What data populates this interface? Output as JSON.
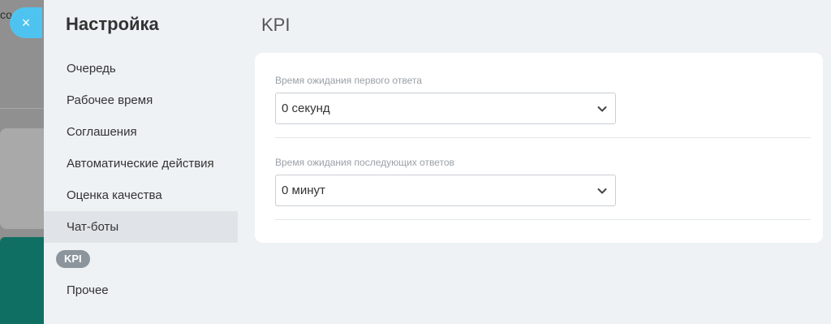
{
  "background": {
    "top_text": "со"
  },
  "close_button": {
    "icon": "×"
  },
  "sidebar": {
    "title": "Настройка",
    "items": [
      {
        "label": "Очередь"
      },
      {
        "label": "Рабочее время"
      },
      {
        "label": "Соглашения"
      },
      {
        "label": "Автоматические действия"
      },
      {
        "label": "Оценка качества"
      },
      {
        "label": "Чат-боты"
      },
      {
        "label": "KPI"
      },
      {
        "label": "Прочее"
      }
    ]
  },
  "main": {
    "title": "KPI",
    "fields": [
      {
        "label": "Время ожидания первого ответа",
        "value": "0 секунд"
      },
      {
        "label": "Время ожидания последующих ответов",
        "value": "0 минут"
      }
    ]
  },
  "colors": {
    "accent": "#4fc3ef",
    "active_pill": "#8c949c",
    "panel_bg": "#eef2f4"
  }
}
